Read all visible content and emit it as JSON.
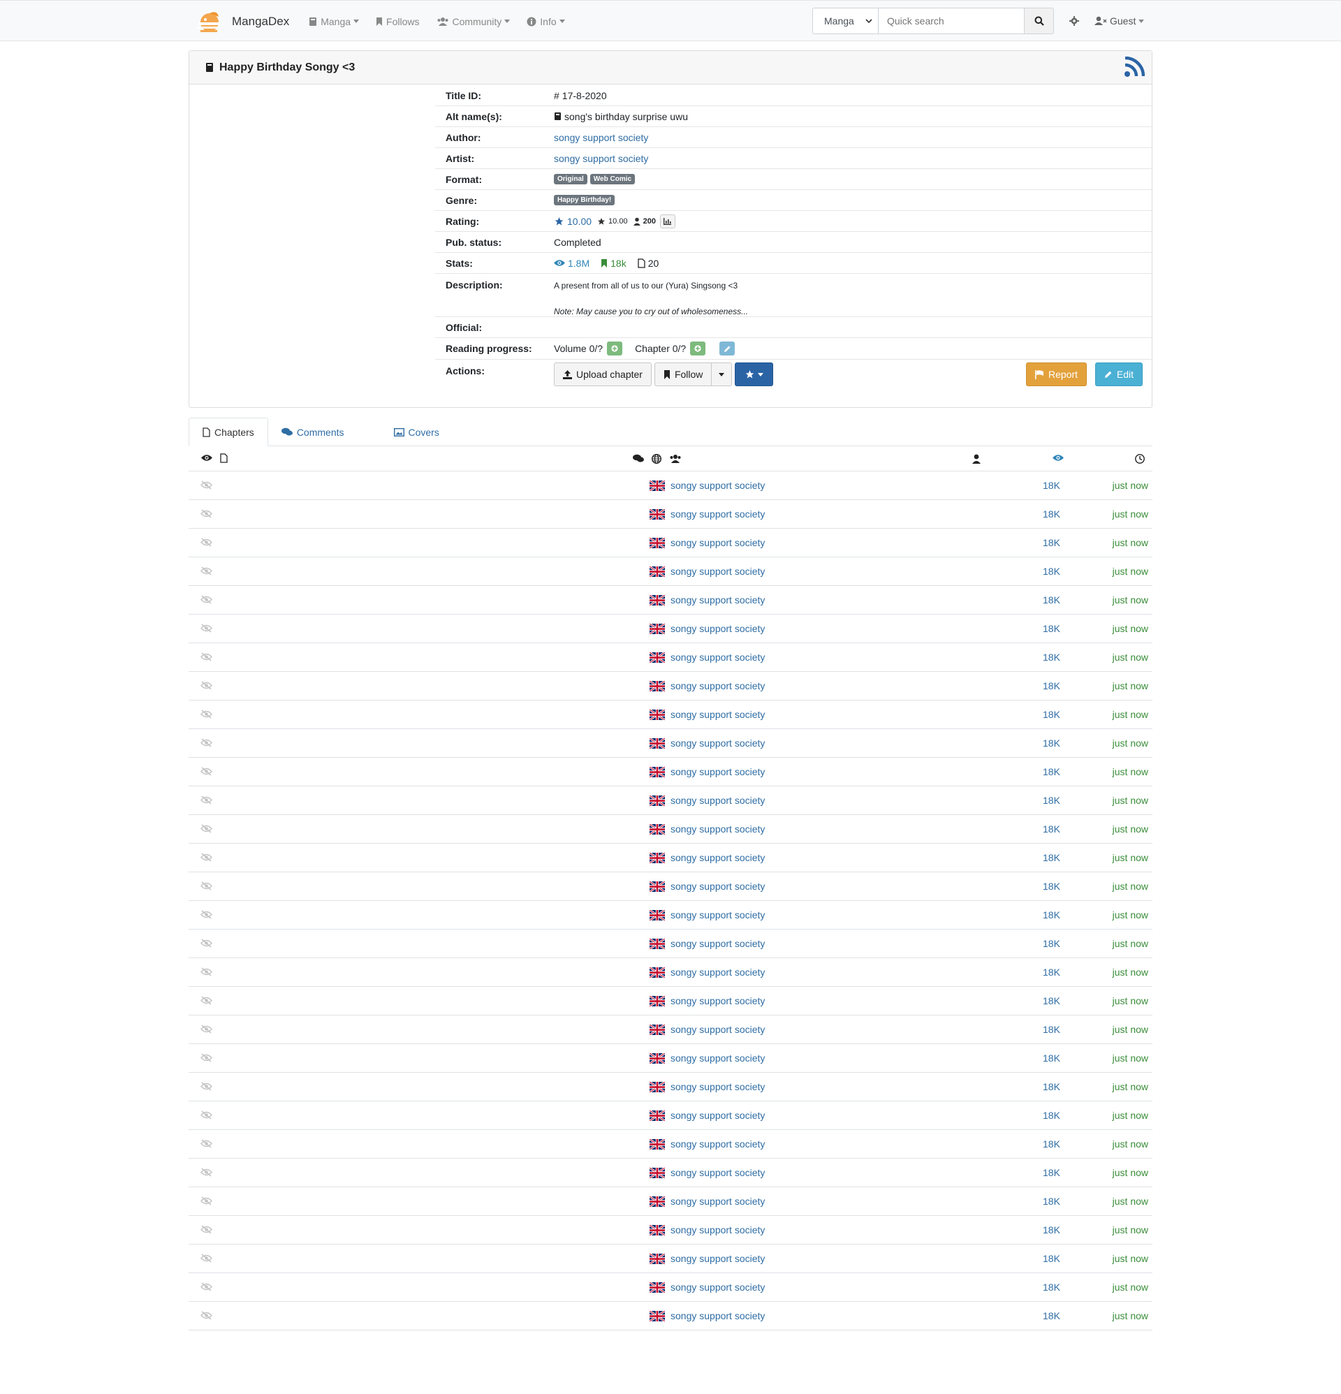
{
  "navbar": {
    "brand": "MangaDex",
    "items": [
      {
        "label": "Manga",
        "icon": "book-icon",
        "dropdown": true
      },
      {
        "label": "Follows",
        "icon": "bookmark-icon",
        "dropdown": false
      },
      {
        "label": "Community",
        "icon": "users-icon",
        "dropdown": true
      },
      {
        "label": "Info",
        "icon": "info-circle-icon",
        "dropdown": true
      }
    ],
    "search_type": "Manga",
    "search_placeholder": "Quick search",
    "user_label": "Guest"
  },
  "title": {
    "name": "Happy Birthday Songy <3",
    "title_id_label": "Title ID:",
    "title_id": "17-8-2020",
    "alt_names_label": "Alt name(s):",
    "alt_name": "song's birthday surprise uwu",
    "author_label": "Author:",
    "author": "songy support society",
    "artist_label": "Artist:",
    "artist": "songy support society",
    "format_label": "Format:",
    "formats": [
      "Original",
      "Web Comic"
    ],
    "genre_label": "Genre:",
    "genres": [
      "Happy Birthday!"
    ],
    "rating_label": "Rating:",
    "rating_bayesian": "10.00",
    "rating_mean": "10.00",
    "rating_users": "200",
    "pub_status_label": "Pub. status:",
    "pub_status": "Completed",
    "stats_label": "Stats:",
    "views": "1.8M",
    "follows": "18k",
    "chapters": "20",
    "description_label": "Description:",
    "description_line1": "A present from all of us to our (Yura) Singsong <3",
    "description_line2": "Note: May cause you to cry out of  wholesomeness...",
    "official_label": "Official:",
    "reading_progress_label": "Reading progress:",
    "volume_progress": "Volume 0/?",
    "chapter_progress": "Chapter 0/?",
    "actions_label": "Actions:",
    "upload_label": "Upload chapter",
    "follow_label": "Follow",
    "report_label": "Report",
    "edit_label": "Edit"
  },
  "tabs": [
    {
      "label": "Chapters",
      "icon": "file-icon",
      "active": true
    },
    {
      "label": "Comments",
      "icon": "comments-icon",
      "active": false
    },
    {
      "label": "Covers",
      "icon": "image-icon",
      "active": false
    }
  ],
  "chapters": {
    "count": 30,
    "group": "songy support society",
    "language_flag": "uk-flag-icon",
    "views": "18K",
    "time": "just now"
  },
  "colors": {
    "link": "#2f6da4",
    "time_green": "#3a8d3a",
    "primary": "#2a64a5",
    "warning": "#e3a13c",
    "info": "#4ab0d4",
    "logo_orange": "#f0932b"
  }
}
